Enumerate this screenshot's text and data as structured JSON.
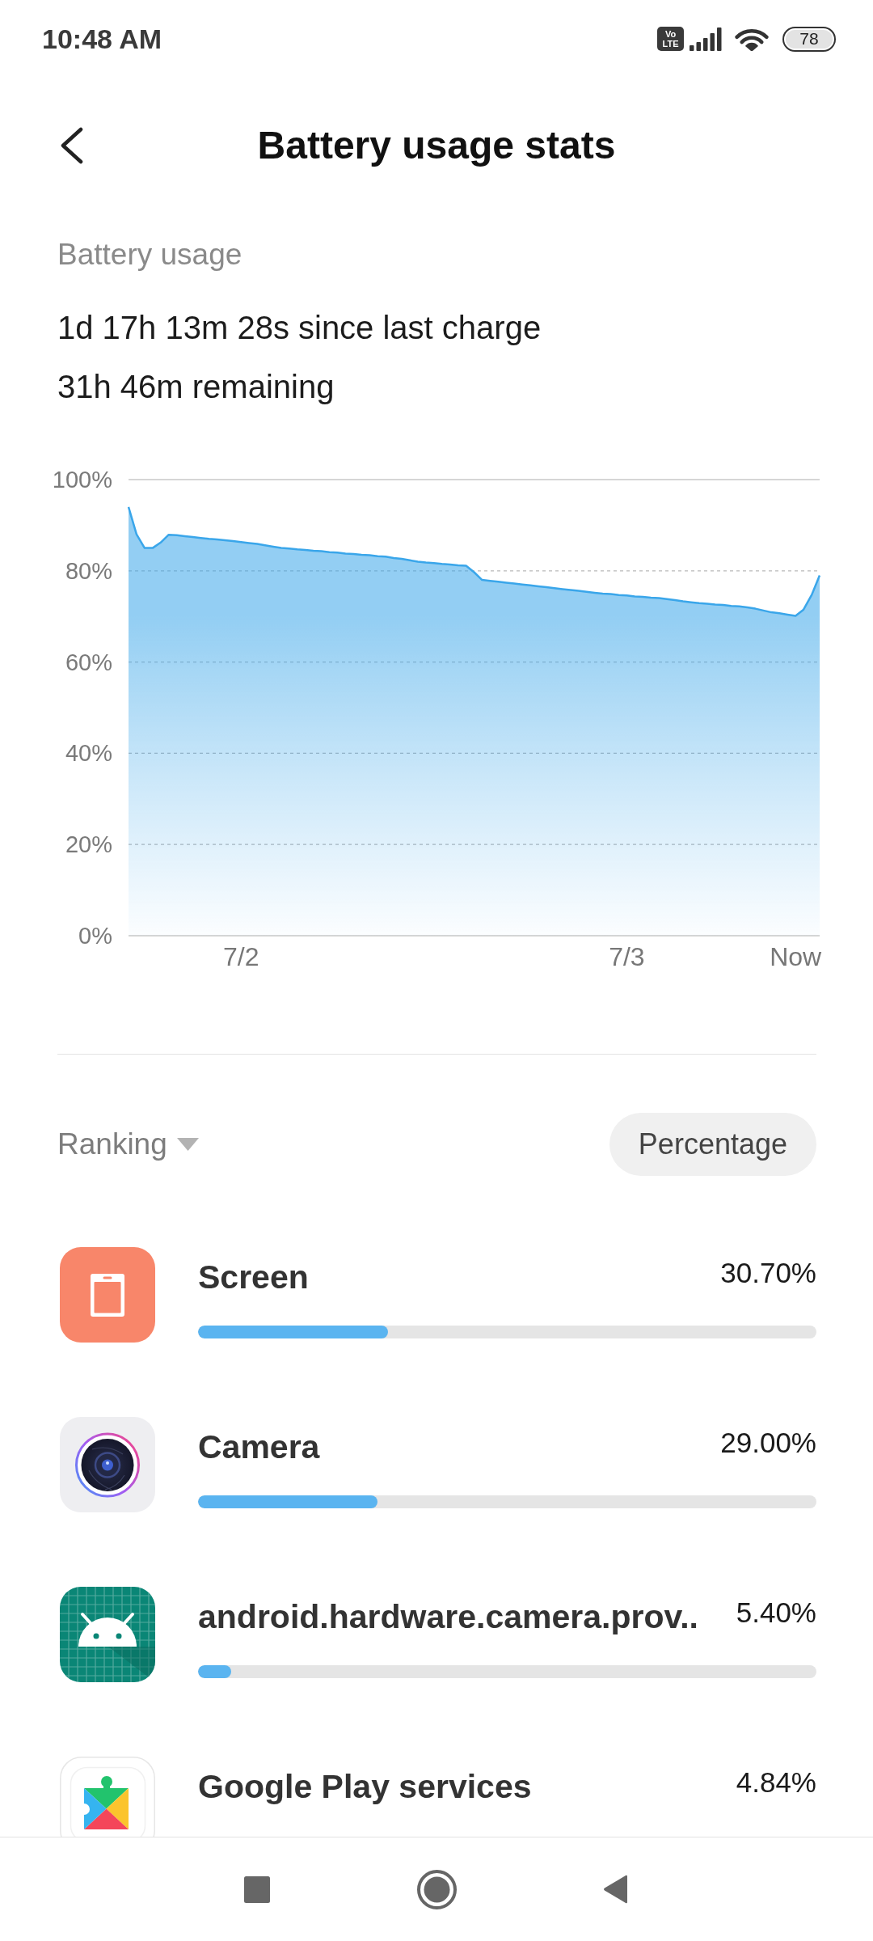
{
  "status_bar": {
    "time": "10:48 AM",
    "network_badge": {
      "line_1": "Vo",
      "line_2": "LTE"
    },
    "battery": "78"
  },
  "header": {
    "title": "Battery usage stats"
  },
  "usage": {
    "heading": "Battery usage",
    "since_charge": "1d 17h 13m 28s since last charge",
    "remaining": "31h 46m remaining",
    "chart_data": {
      "type": "area",
      "categories": [
        null,
        null,
        null,
        null,
        null,
        null,
        null,
        null,
        null,
        null,
        null,
        null,
        null,
        null,
        "7/2",
        null,
        null,
        null,
        null,
        null,
        null,
        null,
        null,
        null,
        null,
        null,
        null,
        null,
        null,
        null,
        null,
        null,
        null,
        null,
        null,
        null,
        null,
        null,
        null,
        null,
        null,
        null,
        null,
        null,
        null,
        null,
        null,
        null,
        null,
        null,
        null,
        null,
        null,
        null,
        null,
        null,
        null,
        null,
        null,
        null,
        null,
        null,
        "7/3",
        null,
        null,
        null,
        null,
        null,
        null,
        null,
        null,
        null,
        null,
        null,
        null,
        null,
        null,
        null,
        null,
        null,
        null,
        null,
        null,
        "Now",
        null,
        null,
        null
      ],
      "series": [
        {
          "color": "#3aa6ea",
          "values": [
            94,
            88,
            85,
            85,
            86.2,
            87.9,
            87.8,
            87.6,
            87.4,
            87.2,
            87,
            86.9,
            86.7,
            86.5,
            86.3,
            86.1,
            85.9,
            85.6,
            85.3,
            85,
            84.9,
            84.7,
            84.6,
            84.4,
            84.3,
            84.1,
            84,
            83.8,
            83.7,
            83.5,
            83.4,
            83.2,
            83.1,
            82.8,
            82.6,
            82.3,
            82,
            81.8,
            81.7,
            81.5,
            81.4,
            81.2,
            81.1,
            79.7,
            78,
            77.8,
            77.6,
            77.4,
            77.2,
            77,
            76.8,
            76.6,
            76.4,
            76.2,
            76,
            75.8,
            75.6,
            75.4,
            75.2,
            75,
            74.9,
            74.7,
            74.6,
            74.4,
            74.3,
            74.1,
            74,
            73.8,
            73.6,
            73.3,
            73.1,
            72.9,
            72.8,
            72.6,
            72.5,
            72.3,
            72.2,
            72,
            71.7,
            71.3,
            70.9,
            70.7,
            70.4,
            70.1,
            71.5,
            74.7,
            79
          ]
        }
      ],
      "ylim": [
        0,
        100
      ],
      "yticks": [
        {
          "value": 0,
          "label": "0%"
        },
        {
          "value": 20,
          "label": "20%"
        },
        {
          "value": 40,
          "label": "40%"
        },
        {
          "value": 60,
          "label": "60%"
        },
        {
          "value": 80,
          "label": "80%"
        },
        {
          "value": 100,
          "label": "100%"
        }
      ],
      "grid": true
    }
  },
  "ranking": {
    "sort_label": "Ranking",
    "mode_button": "Percentage"
  },
  "apps": [
    {
      "kind": "screen",
      "name": "Screen",
      "percent": "30.70%",
      "level": 0.307
    },
    {
      "kind": "camera",
      "name": "Camera",
      "percent": "29.00%",
      "level": 0.29
    },
    {
      "kind": "android",
      "name": "android.hardware.camera.prov..",
      "percent": "5.40%",
      "level": 0.054
    },
    {
      "kind": "play-services",
      "name": "Google Play services",
      "percent": "4.84%"
    }
  ]
}
